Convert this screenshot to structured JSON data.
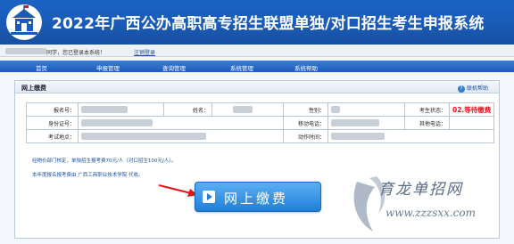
{
  "header": {
    "title": "2022年广西公办高职高专招生联盟单独/对口招生考生申报系统",
    "logo_icon": "school-building-icon"
  },
  "userbar": {
    "welcome": "同学，您已登录本系统！",
    "logout": "注销登录"
  },
  "nav": {
    "items": [
      "首页",
      "申报管理",
      "查询管理",
      "系统管理",
      "系统帮助"
    ]
  },
  "panel": {
    "title": "网上缴费",
    "help": "联机帮助",
    "labels": {
      "exam_no": "报名号：",
      "name": "姓名：",
      "gender": "性别：",
      "status": "考生状态：",
      "id_no": "身份证号：",
      "mobile": "移动电话：",
      "other_phone": "其他电话：",
      "exam_site": "考试地点：",
      "action_time": "动作时间："
    },
    "values": {
      "status": "02.等待缴费"
    },
    "notice1": "经物价部门核定，单独招生报考费70元/人（对口招生100元/人）。",
    "notice2_prefix": "本年度报名报考费由 ",
    "notice2_school": "广西工商职业技术学院",
    "notice2_suffix": " 代收。",
    "pay_button": "网上缴费"
  },
  "watermark": {
    "text": "育龙单招网",
    "url": "www.zzzsxx.com"
  },
  "colors": {
    "header_bg": "#1a5bb7",
    "status_red": "#e8141c",
    "link_blue": "#1a4fa0",
    "button_blue": "#1f7fd7"
  }
}
